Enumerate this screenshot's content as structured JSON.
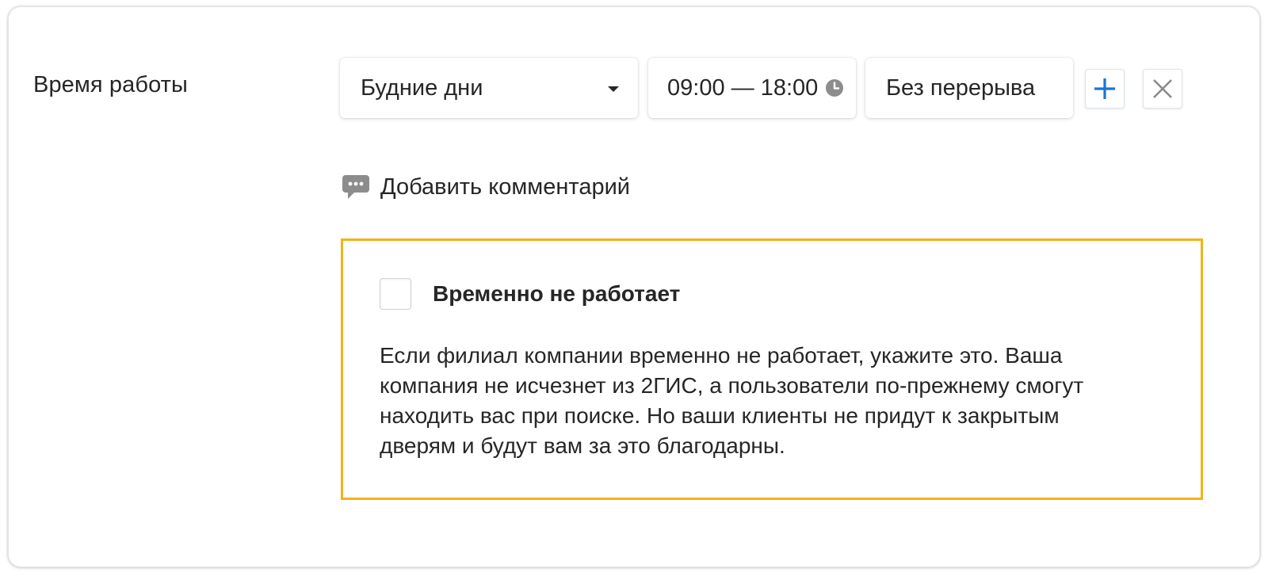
{
  "working_hours": {
    "label": "Время работы",
    "days_select": {
      "value": "Будние дни",
      "icon": "chevron-down-icon"
    },
    "time_field": {
      "value": "09:00 — 18:00",
      "icon": "clock-icon"
    },
    "break_field": {
      "value": "Без перерыва"
    },
    "add_button": {
      "icon": "plus-icon",
      "color": "#1976d2"
    },
    "remove_button": {
      "icon": "close-icon",
      "color": "#8a8a8a"
    }
  },
  "comment": {
    "label": "Добавить комментарий",
    "icon": "comment-icon"
  },
  "temporary_closure": {
    "checkbox_label": "Временно не работает",
    "checked": false,
    "description": "Если филиал компании временно не работает, укажите это. Ваша компания не исчезнет из 2ГИС, а пользователи по-прежнему смогут находить вас при поиске. Но ваши клиенты не придут к закрытым дверям и будут вам за это благодарны.",
    "border_color": "#f2b316"
  }
}
